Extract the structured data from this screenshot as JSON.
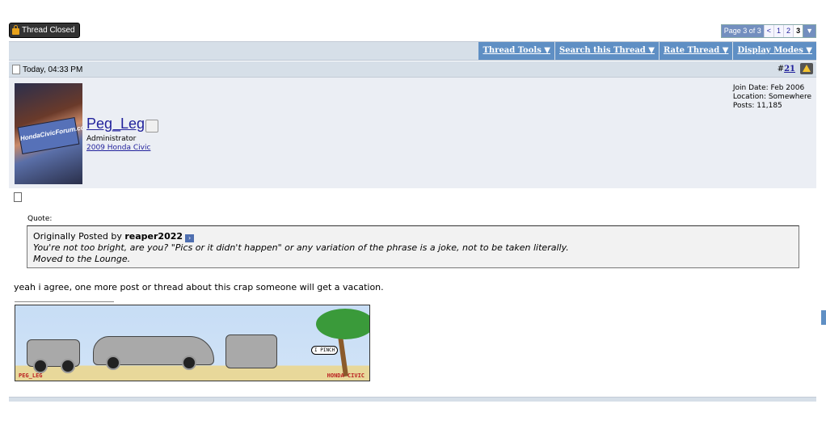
{
  "top": {
    "thread_closed_label": "Thread Closed",
    "pagenav": {
      "label": "Page 3 of 3",
      "prev": "<",
      "pages": [
        "1",
        "2",
        "3"
      ],
      "current": "3",
      "menu": "▼"
    }
  },
  "toolbar": {
    "thread_tools": "Thread Tools ▼",
    "search_thread": "Search this Thread ▼",
    "rate_thread": "Rate Thread ▼",
    "display_modes": "Display Modes ▼"
  },
  "post": {
    "date": "Today, 04:33 PM",
    "number_prefix": "#",
    "number": "21",
    "user": {
      "name": "Peg_Leg",
      "title": "Administrator",
      "car_link": "2009 Honda Civic",
      "avatar_text": "HondaCivicForum.com",
      "join_date": "Join Date: Feb 2006",
      "location": "Location: Somewhere",
      "posts": "Posts: 11,185"
    },
    "quote": {
      "label": "Quote:",
      "intro": "Originally Posted by ",
      "author": "reaper2022",
      "line2": "You're not too bright, are you? \"Pics or it didn't happen\" or any variation of the phrase is a joke, not to be taken literally.",
      "line3": "Moved to the Lounge."
    },
    "message": "yeah i agree, one more post or thread about this crap someone will get a vacation.",
    "signature": {
      "left_text": "PEG_LEG",
      "right_text": "HONDA CIVIC",
      "bubble_text": "I PINCH"
    }
  },
  "colors": {
    "accent": "#5f8fc4",
    "header_bg": "#d6dfe8",
    "userinfo_bg": "#ebeef4",
    "link": "#22229c"
  }
}
